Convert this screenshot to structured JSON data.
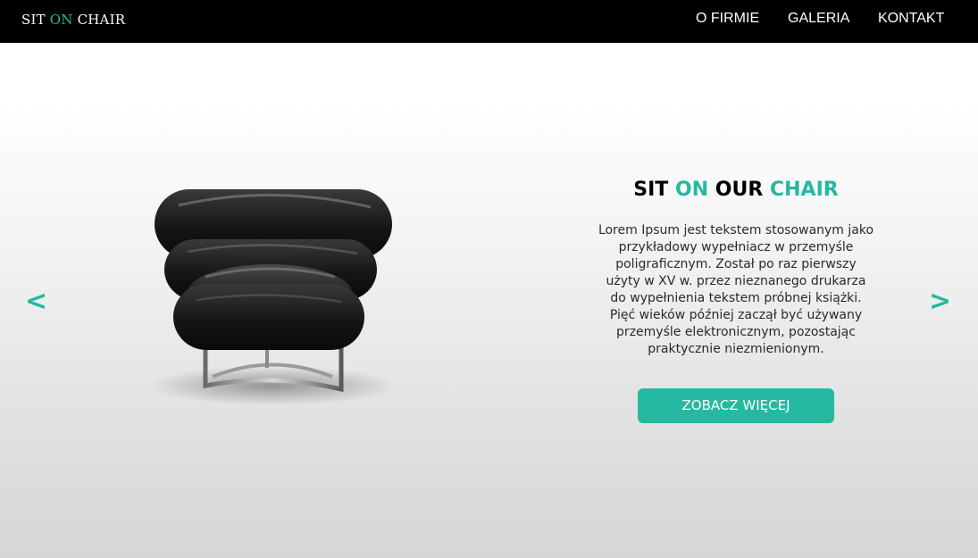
{
  "header": {
    "logo": {
      "part1": "SIT",
      "part2": "ON",
      "part3": "CHAIR"
    },
    "nav": [
      {
        "label": "O FIRMIE"
      },
      {
        "label": "GALERIA"
      },
      {
        "label": "KONTAKT"
      }
    ]
  },
  "slider": {
    "prev_arrow": "<",
    "next_arrow": ">",
    "headline": {
      "w1": "SIT",
      "w2": "ON",
      "w3": "OUR",
      "w4": "CHAIR"
    },
    "description": "Lorem Ipsum jest tekstem stosowanym jako przykładowy wypełniacz w przemyśle poligraficznym. Został po raz pierwszy użyty w XV w. przez nieznanego drukarza do wypełnienia tekstem próbnej książki. Pięć wieków później zaczął być używany przemyśle elektronicznym, pozostając praktycznie niezmienionym.",
    "cta_label": "ZOBACZ WIĘCEJ"
  },
  "colors": {
    "accent": "#24b9a0",
    "header_bg": "#000000",
    "chair_leather": "#141414"
  },
  "icons": {
    "prev": "chevron-left-icon",
    "next": "chevron-right-icon"
  }
}
